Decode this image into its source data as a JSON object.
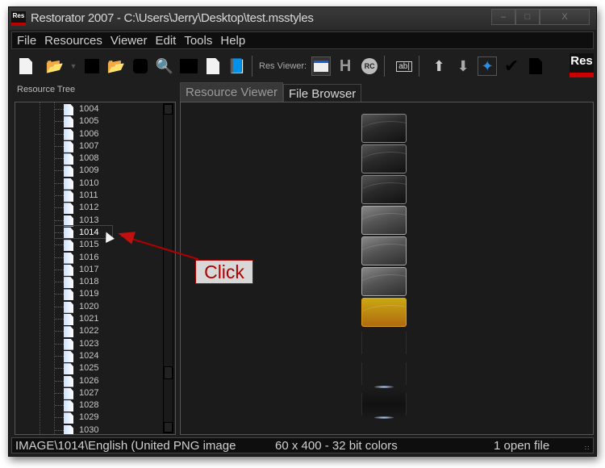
{
  "window": {
    "title": "Restorator 2007 - C:\\Users\\Jerry\\Desktop\\test.msstyles",
    "app_icon_text": "Res",
    "controls": {
      "minimize": "–",
      "maximize": "□",
      "close": "X"
    }
  },
  "menu": [
    "File",
    "Resources",
    "Viewer",
    "Edit",
    "Tools",
    "Help"
  ],
  "toolbar": {
    "buttons": [
      "new-file-icon",
      "open-folder-icon",
      "dropdown-arrow-icon",
      "black-square-icon",
      "open-folder-arrow-icon",
      "extract-icon",
      "search-icon",
      "binary-icon",
      "copy-pages-icon",
      "help-book-icon"
    ],
    "res_viewer_label": "Res Viewer:",
    "viewer_buttons": [
      "image-viewer-icon",
      "hex-icon",
      "rc-icon",
      "text-edit-icon",
      "move-up-icon",
      "move-down-icon",
      "navigate-icon",
      "checkmark-icon",
      "page-icon"
    ],
    "logo_text": "Res"
  },
  "resource_tree": {
    "label": "Resource Tree",
    "items": [
      "1004",
      "1005",
      "1006",
      "1007",
      "1008",
      "1009",
      "1010",
      "1011",
      "1012",
      "1013",
      "1014",
      "1015",
      "1016",
      "1017",
      "1018",
      "1019",
      "1020",
      "1021",
      "1022",
      "1023",
      "1024",
      "1025",
      "1026",
      "1027",
      "1028",
      "1029",
      "1030"
    ],
    "selected": "1014"
  },
  "tabs": [
    {
      "label": "Resource Viewer",
      "active": true
    },
    {
      "label": "File Browser",
      "active": false
    }
  ],
  "annotation": {
    "label": "Click",
    "color": "#c01010"
  },
  "status": {
    "path": "IMAGE\\1014\\English (United PNG image",
    "dimensions": "60 x 400 - 32 bit colors",
    "files": "1 open file"
  }
}
